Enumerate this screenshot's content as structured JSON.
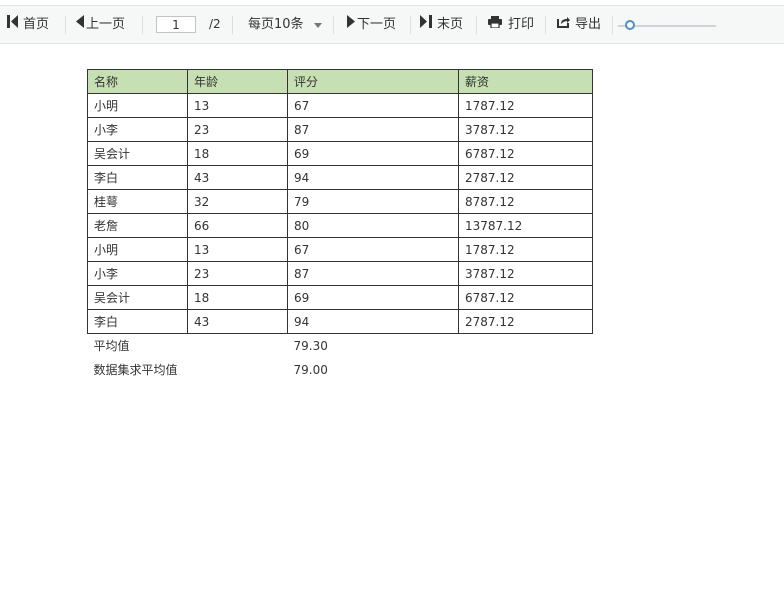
{
  "toolbar": {
    "first_label": "首页",
    "prev_label": "上一页",
    "current_page": "1",
    "total_pages": "/2",
    "page_size_label": "每页10条",
    "next_label": "下一页",
    "last_label": "末页",
    "print_label": "打印",
    "export_label": "导出",
    "zoom_level": 0.1,
    "icons": {
      "first": "first-page-icon",
      "prev": "prev-page-icon",
      "dropdown": "chevron-down-icon",
      "next": "next-page-icon",
      "last": "last-page-icon",
      "print": "printer-icon",
      "export": "export-icon"
    }
  },
  "table": {
    "header_color": "#c6e0b4",
    "headers": [
      "名称",
      "年龄",
      "评分",
      "薪资"
    ],
    "rows": [
      [
        "小明",
        "13",
        "67",
        "1787.12"
      ],
      [
        "小李",
        "23",
        "87",
        "3787.12"
      ],
      [
        "吴会计",
        "18",
        "69",
        "6787.12"
      ],
      [
        "李白",
        "43",
        "94",
        "2787.12"
      ],
      [
        "桂萼",
        "32",
        "79",
        "8787.12"
      ],
      [
        "老詹",
        "66",
        "80",
        "13787.12"
      ],
      [
        "小明",
        "13",
        "67",
        "1787.12"
      ],
      [
        "小李",
        "23",
        "87",
        "3787.12"
      ],
      [
        "吴会计",
        "18",
        "69",
        "6787.12"
      ],
      [
        "李白",
        "43",
        "94",
        "2787.12"
      ]
    ],
    "summary": [
      {
        "label": "平均值",
        "value": "79.30"
      },
      {
        "label": "数据集求平均值",
        "value": "79.00"
      }
    ]
  }
}
